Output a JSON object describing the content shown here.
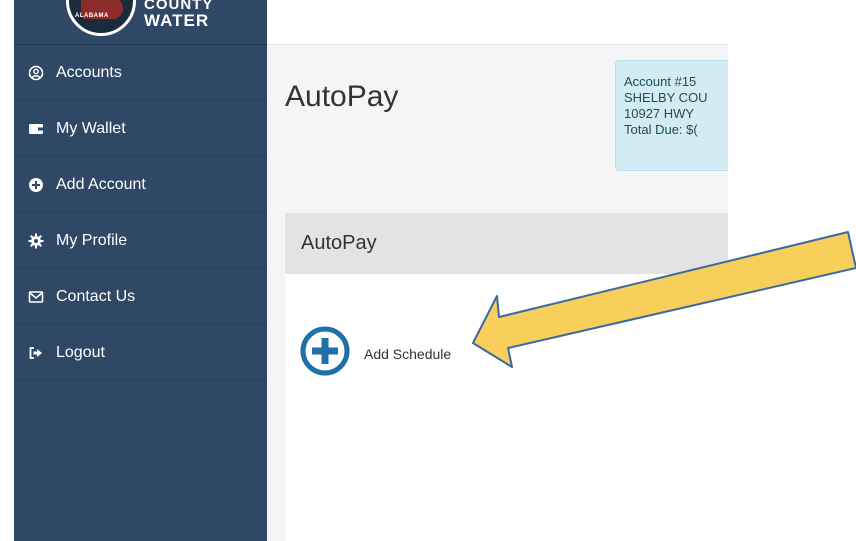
{
  "logo": {
    "line1": "COUNTY",
    "line2": "WATER",
    "ring_text": "ALABAMA"
  },
  "sidebar": {
    "items": [
      {
        "label": "Accounts",
        "icon": "user-circle-icon"
      },
      {
        "label": "My Wallet",
        "icon": "wallet-icon"
      },
      {
        "label": "Add Account",
        "icon": "plus-circle-icon"
      },
      {
        "label": "My Profile",
        "icon": "gear-icon"
      },
      {
        "label": "Contact Us",
        "icon": "envelope-icon"
      },
      {
        "label": "Logout",
        "icon": "logout-icon"
      }
    ]
  },
  "main": {
    "title": "AutoPay",
    "account": {
      "number": "Account #15",
      "name": "SHELBY COU",
      "address": "10927 HWY",
      "total_due": "Total Due: $("
    },
    "card": {
      "header": "AutoPay",
      "add_schedule_label": "Add Schedule"
    }
  },
  "colors": {
    "sidebar": "#2f4866",
    "accent": "#1f6fa8",
    "arrow_fill": "#f8cf5a",
    "arrow_stroke": "#3b6aa0"
  }
}
